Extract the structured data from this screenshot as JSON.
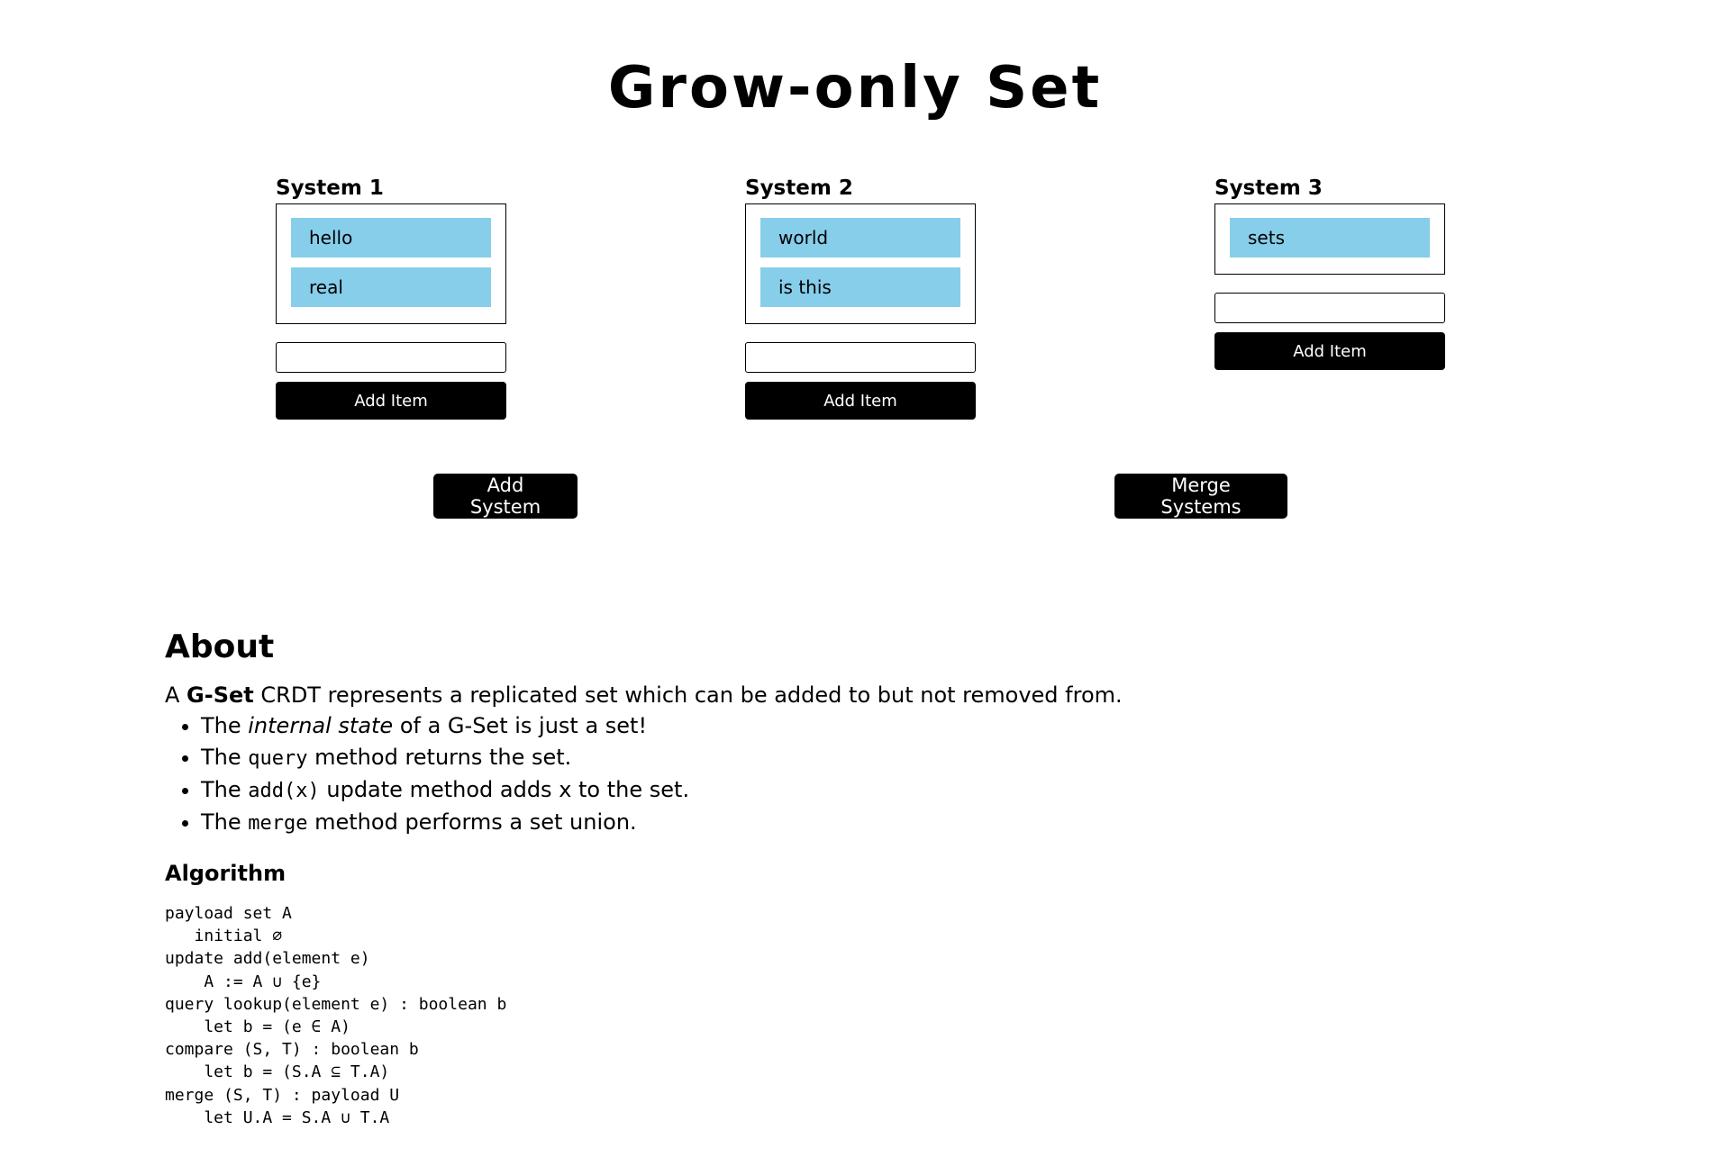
{
  "title": "Grow-only Set",
  "systems": [
    {
      "title": "System 1",
      "items": [
        "hello",
        "real"
      ],
      "input_value": "",
      "add_label": "Add Item"
    },
    {
      "title": "System 2",
      "items": [
        "world",
        "is this"
      ],
      "input_value": "",
      "add_label": "Add Item"
    },
    {
      "title": "System 3",
      "items": [
        "sets"
      ],
      "input_value": "",
      "add_label": "Add Item"
    }
  ],
  "actions": {
    "add_system": "Add System",
    "merge_systems": "Merge Systems"
  },
  "about": {
    "heading": "About",
    "intro": {
      "a": "A ",
      "gset": "G-Set",
      "rest": " CRDT represents a replicated set which can be added to but not removed from."
    },
    "bullets": [
      {
        "pre": "The ",
        "em": "internal state",
        "post": " of a G-Set is just a set!"
      },
      {
        "pre": "The ",
        "code": "query",
        "post": " method returns the set."
      },
      {
        "pre": "The ",
        "code": "add(x)",
        "post": " update method adds x to the set."
      },
      {
        "pre": "The ",
        "code": "merge",
        "post": " method performs a set union."
      }
    ],
    "algorithm_heading": "Algorithm",
    "algorithm": "payload set A\n   initial ∅\nupdate add(element e)\n    A := A ∪ {e}\nquery lookup(element e) : boolean b\n    let b = (e ∈ A)\ncompare (S, T) : boolean b\n    let b = (S.A ⊆ T.A)\nmerge (S, T) : payload U\n    let U.A = S.A ∪ T.A"
  },
  "colors": {
    "item_bg": "#87ceeb",
    "button_bg": "#000000"
  }
}
